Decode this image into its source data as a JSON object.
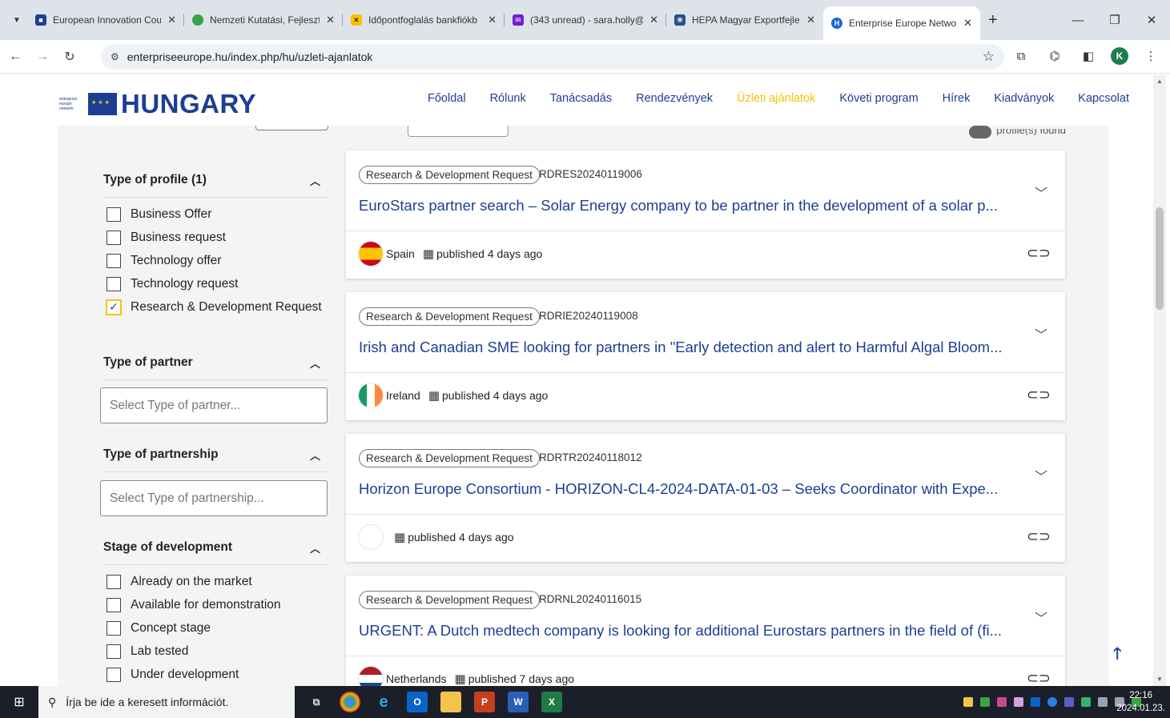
{
  "browser": {
    "tabs": [
      {
        "title": "European Innovation Coun",
        "fav_color": "#1c3f94",
        "fav_glyph": "■"
      },
      {
        "title": "Nemzeti Kutatási, Fejleszté",
        "fav_color": "#3aa346",
        "fav_glyph": "●"
      },
      {
        "title": "Időpontfoglalás bankfiókb",
        "fav_color": "#f5c400",
        "fav_glyph": "✕"
      },
      {
        "title": "(343 unread) - sara.holly@",
        "fav_color": "#6b1fd1",
        "fav_glyph": "✉"
      },
      {
        "title": "HEPA Magyar Exportfejlesz",
        "fav_color": "#26508f",
        "fav_glyph": "❋"
      },
      {
        "title": "Enterprise Europe Network",
        "fav_color": "#1c63d6",
        "fav_glyph": "H"
      }
    ],
    "url": "enterpriseeurope.hu/index.php/hu/uzleti-ajanlatok",
    "profile_initial": "K"
  },
  "site": {
    "logo_text": "HUNGARY",
    "logo_small": [
      "enterprise",
      "europe",
      "network"
    ],
    "nav": [
      "Főoldal",
      "Rólunk",
      "Tanácsadás",
      "Rendezvények",
      "Üzleti ajánlatok",
      "Követi program",
      "Hírek",
      "Kiadványok",
      "Kapcsolat"
    ],
    "nav_current_index": 4
  },
  "results_suffix": "profile(s) found",
  "filters": {
    "type_of_profile": {
      "title": "Type of profile (1)",
      "options": [
        "Business Offer",
        "Business request",
        "Technology offer",
        "Technology request",
        "Research & Development Request"
      ],
      "checked": [
        false,
        false,
        false,
        false,
        true
      ]
    },
    "type_of_partner": {
      "title": "Type of partner",
      "placeholder": "Select Type of partner..."
    },
    "type_of_partnership": {
      "title": "Type of partnership",
      "placeholder": "Select Type of partnership..."
    },
    "stage_of_development": {
      "title": "Stage of development",
      "options": [
        "Already on the market",
        "Available for demonstration",
        "Concept stage",
        "Lab tested",
        "Under development"
      ]
    }
  },
  "profiles": [
    {
      "type": "Research & Development Request",
      "ref": "RDRES20240119006",
      "title": "EuroStars partner search – Solar Energy company to be partner in the development of a solar p...",
      "country": "Spain",
      "published": "published 4 days ago"
    },
    {
      "type": "Research & Development Request",
      "ref": "RDRIE20240119008",
      "title": "Irish and Canadian SME looking for partners in \"Early detection and alert to Harmful Algal Bloom...",
      "country": "Ireland",
      "published": "published 4 days ago"
    },
    {
      "type": "Research & Development Request",
      "ref": "RDRTR20240118012",
      "title": "Horizon Europe Consortium - HORIZON-CL4-2024-DATA-01-03 – Seeks Coordinator with Expe...",
      "country": "",
      "published": "published 4 days ago"
    },
    {
      "type": "Research & Development Request",
      "ref": "RDRNL20240116015",
      "title": "URGENT: A Dutch medtech company is looking for additional Eurostars partners in the field of (fi...",
      "country": "Netherlands",
      "published": "published 7 days ago"
    }
  ],
  "taskbar": {
    "search_placeholder": "Írja be ide a keresett információt.",
    "time": "22:16",
    "date": "2024.01.23."
  }
}
